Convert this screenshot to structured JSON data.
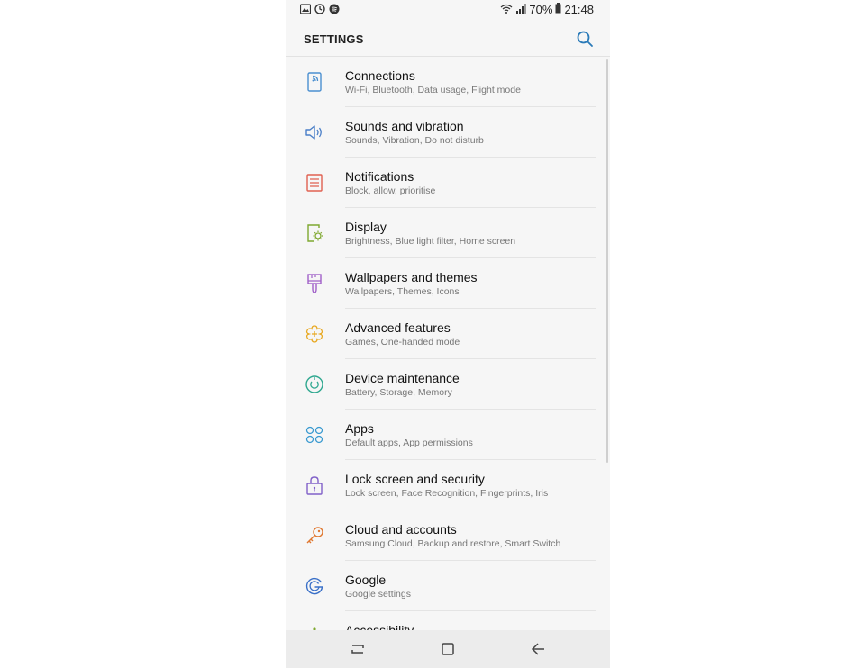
{
  "status_bar": {
    "left_icons": [
      "gallery-icon",
      "clock-icon",
      "spotify-icon"
    ],
    "battery_percent": "70%",
    "time": "21:48"
  },
  "header": {
    "title": "SETTINGS",
    "search_icon": "search-icon"
  },
  "colors": {
    "accent": "#2a7ab8",
    "connections": "#4a8fd0",
    "sounds": "#4a7fc8",
    "notifications": "#e06050",
    "display": "#7fa830",
    "wallpapers": "#a060c8",
    "advanced": "#e8a820",
    "maintenance": "#30a890",
    "apps": "#3a9ad0",
    "lock": "#8060c8",
    "cloud": "#e07830",
    "google": "#3a70c8"
  },
  "settings": [
    {
      "title": "Connections",
      "subtitle": "Wi-Fi, Bluetooth, Data usage, Flight mode",
      "icon": "connections-icon"
    },
    {
      "title": "Sounds and vibration",
      "subtitle": "Sounds, Vibration, Do not disturb",
      "icon": "speaker-icon"
    },
    {
      "title": "Notifications",
      "subtitle": "Block, allow, prioritise",
      "icon": "notifications-icon"
    },
    {
      "title": "Display",
      "subtitle": "Brightness, Blue light filter, Home screen",
      "icon": "display-icon"
    },
    {
      "title": "Wallpapers and themes",
      "subtitle": "Wallpapers, Themes, Icons",
      "icon": "brush-icon"
    },
    {
      "title": "Advanced features",
      "subtitle": "Games, One-handed mode",
      "icon": "advanced-features-icon"
    },
    {
      "title": "Device maintenance",
      "subtitle": "Battery, Storage, Memory",
      "icon": "maintenance-icon"
    },
    {
      "title": "Apps",
      "subtitle": "Default apps, App permissions",
      "icon": "apps-icon"
    },
    {
      "title": "Lock screen and security",
      "subtitle": "Lock screen, Face Recognition, Fingerprints, Iris",
      "icon": "lock-icon"
    },
    {
      "title": "Cloud and accounts",
      "subtitle": "Samsung Cloud, Backup and restore, Smart Switch",
      "icon": "key-icon"
    },
    {
      "title": "Google",
      "subtitle": "Google settings",
      "icon": "google-icon"
    },
    {
      "title": "Accessibility",
      "subtitle": "",
      "icon": "accessibility-icon"
    }
  ],
  "nav_bar": {
    "recents": "recents-icon",
    "home": "home-icon",
    "back": "back-icon"
  }
}
